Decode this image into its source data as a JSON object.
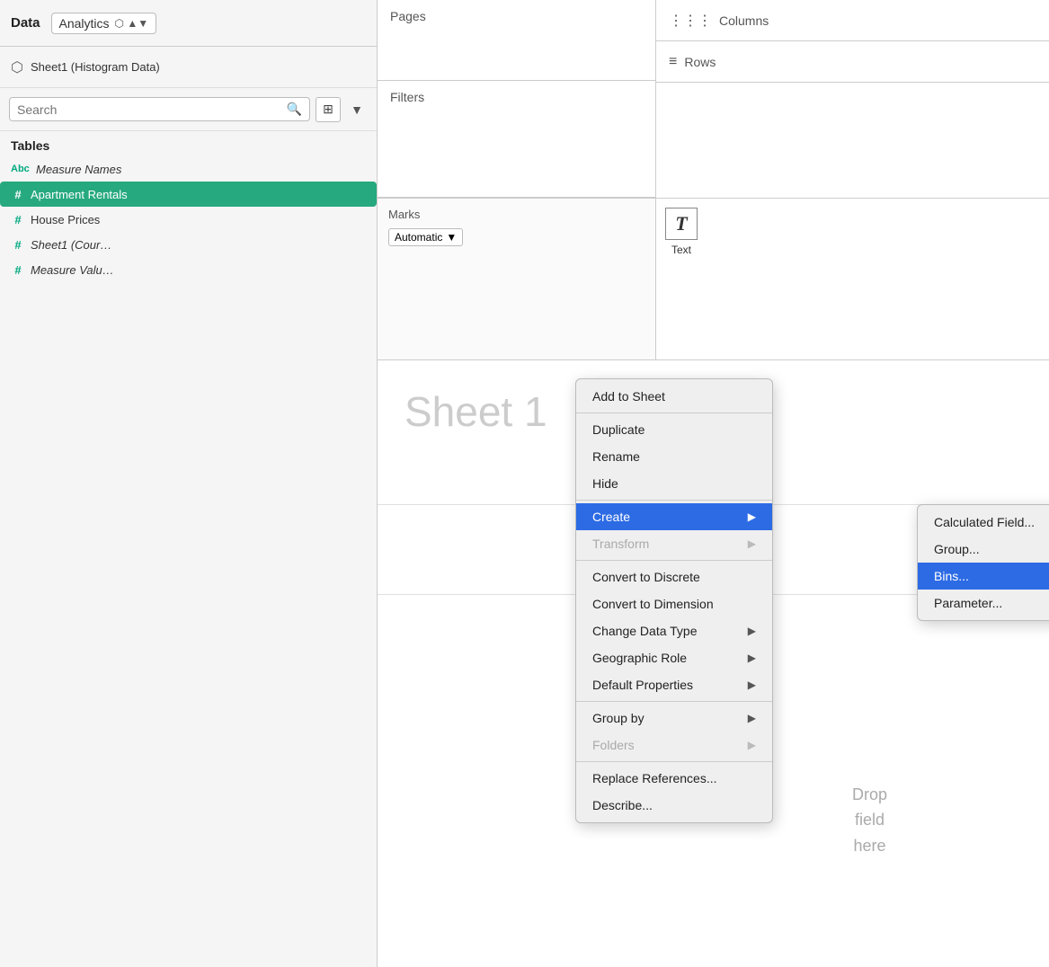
{
  "leftPanel": {
    "title": "Data",
    "analyticsLabel": "Analytics",
    "datasource": "Sheet1 (Histogram Data)",
    "search": {
      "placeholder": "Search"
    },
    "tablesLabel": "Tables",
    "fields": [
      {
        "type": "abc",
        "name": "Measure Names",
        "italic": true,
        "selected": false
      },
      {
        "type": "hash",
        "name": "Apartment Rentals",
        "italic": false,
        "selected": true
      },
      {
        "type": "hash",
        "name": "House Prices",
        "italic": false,
        "selected": false
      },
      {
        "type": "hash",
        "name": "Sheet1 (Cour…",
        "italic": true,
        "selected": false
      },
      {
        "type": "hash",
        "name": "Measure Valu…",
        "italic": true,
        "selected": false
      }
    ]
  },
  "shelves": {
    "pages": "Pages",
    "filters": "Filters",
    "columns": "Columns",
    "rows": "Rows",
    "marks": "Marks",
    "marksType": "Automatic",
    "textLabel": "Text"
  },
  "canvas": {
    "sheetTitle": "Sheet 1",
    "dropFieldHere": "Drop\nfield\nhere"
  },
  "contextMenu": {
    "items": [
      {
        "label": "Add to Sheet",
        "hasArrow": false,
        "disabled": false,
        "highlighted": false,
        "separator": false
      },
      {
        "label": "",
        "hasArrow": false,
        "disabled": false,
        "highlighted": false,
        "separator": true
      },
      {
        "label": "Duplicate",
        "hasArrow": false,
        "disabled": false,
        "highlighted": false,
        "separator": false
      },
      {
        "label": "Rename",
        "hasArrow": false,
        "disabled": false,
        "highlighted": false,
        "separator": false
      },
      {
        "label": "Hide",
        "hasArrow": false,
        "disabled": false,
        "highlighted": false,
        "separator": false
      },
      {
        "label": "",
        "hasArrow": false,
        "disabled": false,
        "highlighted": false,
        "separator": true
      },
      {
        "label": "Create",
        "hasArrow": true,
        "disabled": false,
        "highlighted": true,
        "separator": false
      },
      {
        "label": "Transform",
        "hasArrow": true,
        "disabled": true,
        "highlighted": false,
        "separator": false
      },
      {
        "label": "",
        "hasArrow": false,
        "disabled": false,
        "highlighted": false,
        "separator": true
      },
      {
        "label": "Convert to Discrete",
        "hasArrow": false,
        "disabled": false,
        "highlighted": false,
        "separator": false
      },
      {
        "label": "Convert to Dimension",
        "hasArrow": false,
        "disabled": false,
        "highlighted": false,
        "separator": false
      },
      {
        "label": "Change Data Type",
        "hasArrow": true,
        "disabled": false,
        "highlighted": false,
        "separator": false
      },
      {
        "label": "Geographic Role",
        "hasArrow": true,
        "disabled": false,
        "highlighted": false,
        "separator": false
      },
      {
        "label": "Default Properties",
        "hasArrow": true,
        "disabled": false,
        "highlighted": false,
        "separator": false
      },
      {
        "label": "",
        "hasArrow": false,
        "disabled": false,
        "highlighted": false,
        "separator": true
      },
      {
        "label": "Group by",
        "hasArrow": true,
        "disabled": false,
        "highlighted": false,
        "separator": false
      },
      {
        "label": "Folders",
        "hasArrow": true,
        "disabled": true,
        "highlighted": false,
        "separator": false
      },
      {
        "label": "",
        "hasArrow": false,
        "disabled": false,
        "highlighted": false,
        "separator": true
      },
      {
        "label": "Replace References...",
        "hasArrow": false,
        "disabled": false,
        "highlighted": false,
        "separator": false
      },
      {
        "label": "Describe...",
        "hasArrow": false,
        "disabled": false,
        "highlighted": false,
        "separator": false
      }
    ],
    "subMenu": {
      "items": [
        {
          "label": "Calculated Field...",
          "highlighted": false
        },
        {
          "label": "Group...",
          "highlighted": false
        },
        {
          "label": "Bins...",
          "highlighted": true
        },
        {
          "label": "Parameter...",
          "highlighted": false
        }
      ]
    }
  },
  "colors": {
    "teal": "#00a97f",
    "selectedGreen": "#26a97e",
    "highlightBlue": "#2d6be4",
    "disabledGray": "#aaa"
  }
}
